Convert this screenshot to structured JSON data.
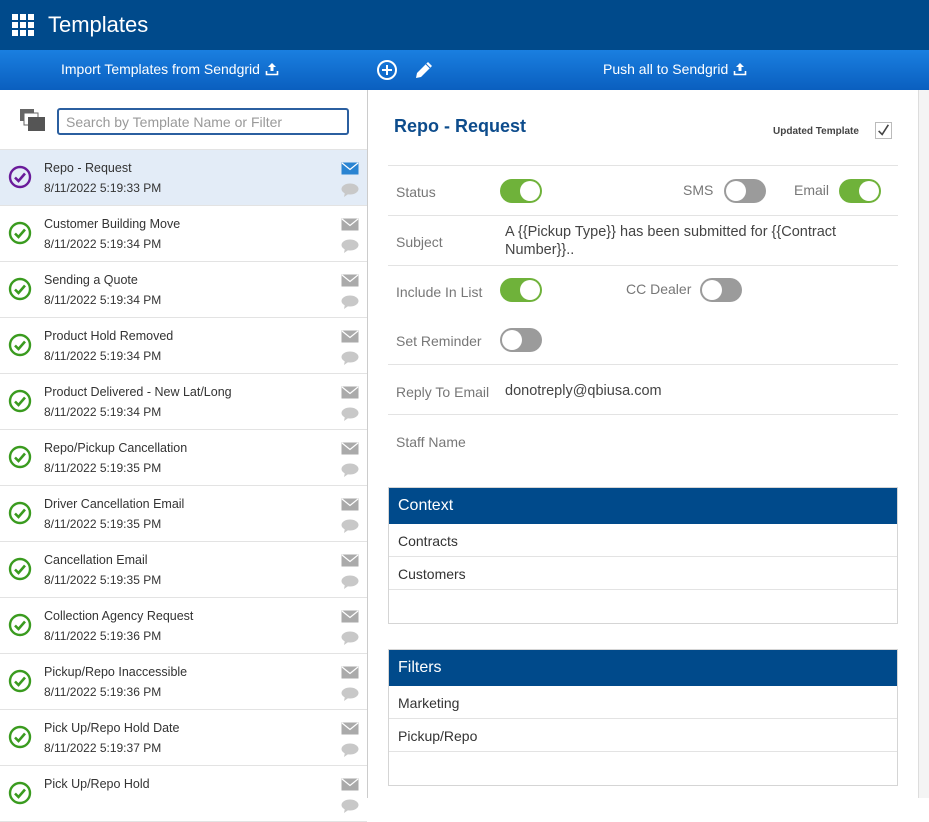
{
  "app": {
    "title": "Templates"
  },
  "toolbar": {
    "import_label": "Import Templates from Sendgrid",
    "push_label": "Push all to Sendgrid"
  },
  "search": {
    "placeholder": "Search by Template Name or Filter",
    "value": ""
  },
  "templates": [
    {
      "name": "Repo - Request",
      "date": "8/11/2022 5:19:33 PM",
      "selected": true
    },
    {
      "name": "Customer Building Move",
      "date": "8/11/2022 5:19:34 PM"
    },
    {
      "name": "Sending a Quote",
      "date": "8/11/2022 5:19:34 PM"
    },
    {
      "name": "Product Hold Removed",
      "date": "8/11/2022 5:19:34 PM"
    },
    {
      "name": "Product Delivered - New Lat/Long",
      "date": "8/11/2022 5:19:34 PM"
    },
    {
      "name": "Repo/Pickup Cancellation",
      "date": "8/11/2022 5:19:35 PM"
    },
    {
      "name": "Driver Cancellation Email",
      "date": "8/11/2022 5:19:35 PM"
    },
    {
      "name": "Cancellation Email",
      "date": "8/11/2022 5:19:35 PM"
    },
    {
      "name": "Collection Agency Request",
      "date": "8/11/2022 5:19:36 PM"
    },
    {
      "name": "Pickup/Repo Inaccessible",
      "date": "8/11/2022 5:19:36 PM"
    },
    {
      "name": "Pick Up/Repo Hold Date",
      "date": "8/11/2022 5:19:37 PM"
    },
    {
      "name": "Pick Up/Repo Hold",
      "date": ""
    }
  ],
  "detail": {
    "title": "Repo - Request",
    "updated_label": "Updated Template",
    "updated_checked": true,
    "status_label": "Status",
    "status_on": true,
    "sms_label": "SMS",
    "sms_on": false,
    "email_label": "Email",
    "email_on": true,
    "subject_label": "Subject",
    "subject_line1": "A {{Pickup Type}} has been submitted for {{Contract",
    "subject_line2": "Number}}..",
    "include_label": "Include In List",
    "include_on": true,
    "cc_label": "CC Dealer",
    "cc_on": false,
    "reminder_label": "Set Reminder",
    "reminder_on": false,
    "reply_label": "Reply To Email",
    "reply_value": "donotreply@qbiusa.com",
    "staff_label": "Staff Name"
  },
  "context": {
    "header": "Context",
    "items": [
      "Contracts",
      "Customers"
    ]
  },
  "filters": {
    "header": "Filters",
    "items": [
      "Marketing",
      "Pickup/Repo"
    ]
  },
  "colors": {
    "brand": "#004a8b",
    "toolbar": "#1a7fe0",
    "toggle_on": "#6fb23a",
    "check_green": "#3a9b1f",
    "check_purple": "#6a1b9a"
  }
}
